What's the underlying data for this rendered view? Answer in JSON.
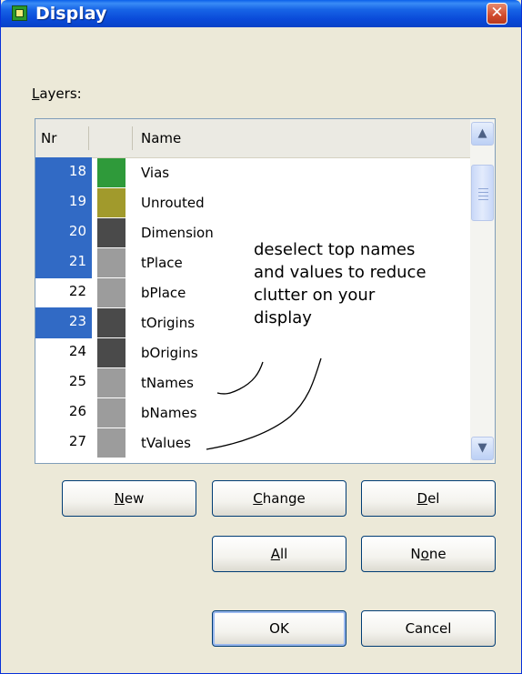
{
  "window": {
    "title": "Display",
    "close_glyph": "✕"
  },
  "layers_label": "Layers:",
  "table": {
    "columns": [
      "Nr",
      "Name"
    ],
    "rows": [
      {
        "nr": "18",
        "name": "Vias",
        "color": "#2f9a3a",
        "selected": true
      },
      {
        "nr": "19",
        "name": "Unrouted",
        "color": "#a19a2c",
        "selected": true
      },
      {
        "nr": "20",
        "name": "Dimension",
        "color": "#4a4a4a",
        "selected": true
      },
      {
        "nr": "21",
        "name": "tPlace",
        "color": "#9c9c9c",
        "selected": true
      },
      {
        "nr": "22",
        "name": "bPlace",
        "color": "#9c9c9c",
        "selected": false
      },
      {
        "nr": "23",
        "name": "tOrigins",
        "color": "#4a4a4a",
        "selected": true
      },
      {
        "nr": "24",
        "name": "bOrigins",
        "color": "#4a4a4a",
        "selected": false
      },
      {
        "nr": "25",
        "name": "tNames",
        "color": "#9c9c9c",
        "selected": false
      },
      {
        "nr": "26",
        "name": "bNames",
        "color": "#9c9c9c",
        "selected": false
      },
      {
        "nr": "27",
        "name": "tValues",
        "color": "#9c9c9c",
        "selected": false
      }
    ]
  },
  "annotation": "deselect top names\nand values to reduce\nclutter on your\ndisplay",
  "buttons": {
    "new": "New",
    "change": "Change",
    "del": "Del",
    "all": "All",
    "none": "None",
    "ok": "OK",
    "cancel": "Cancel"
  },
  "colors": {
    "selection": "#316ac5",
    "titlebar": "#0a4ad9",
    "dialog_bg": "#ece9d8"
  }
}
